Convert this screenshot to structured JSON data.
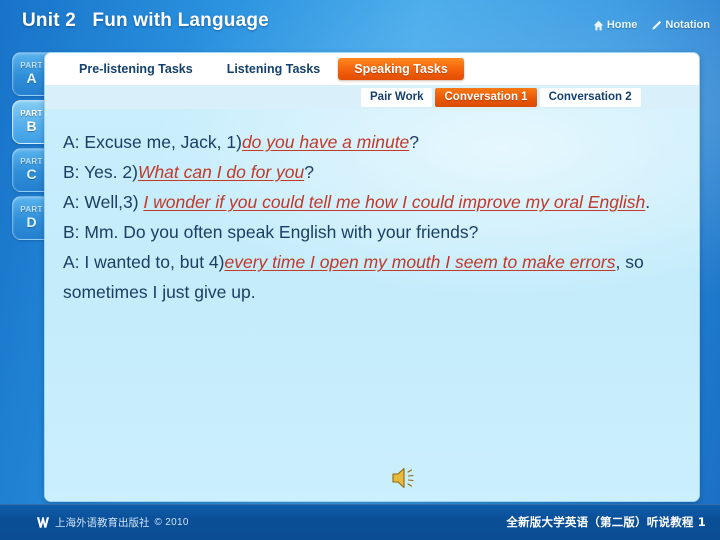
{
  "header": {
    "title": "Unit 2   Fun with Language",
    "nav": [
      {
        "label": "Home",
        "icon": "home-icon"
      },
      {
        "label": "Notation",
        "icon": "pencil-icon"
      }
    ]
  },
  "sidebar": {
    "parts": [
      {
        "top": "PART",
        "letter": "A",
        "active": false
      },
      {
        "top": "PART",
        "letter": "B",
        "active": true
      },
      {
        "top": "PART",
        "letter": "C",
        "active": false
      },
      {
        "top": "PART",
        "letter": "D",
        "active": false
      }
    ]
  },
  "tabs": [
    {
      "label": "Pre-listening Tasks",
      "active": false
    },
    {
      "label": "Listening Tasks",
      "active": false
    },
    {
      "label": "Speaking Tasks",
      "active": true
    }
  ],
  "subtabs": [
    {
      "label": "Pair Work",
      "active": false
    },
    {
      "label": "Conversation 1",
      "active": true
    },
    {
      "label": "Conversation 2",
      "active": false
    }
  ],
  "dialogue": {
    "lines": [
      {
        "segments": [
          {
            "text": "A: Excuse me, Jack, 1)",
            "answer": false
          },
          {
            "text": "do you have a minute",
            "answer": true
          },
          {
            "text": "?",
            "answer": false
          }
        ]
      },
      {
        "segments": [
          {
            "text": "B: Yes. 2)",
            "answer": false
          },
          {
            "text": "What can I do for you",
            "answer": true
          },
          {
            "text": "?",
            "answer": false
          }
        ]
      },
      {
        "segments": [
          {
            "text": "A: Well,3) ",
            "answer": false
          },
          {
            "text": "I wonder if you could tell me how I could improve my oral English",
            "answer": true
          },
          {
            "text": ".",
            "answer": false
          }
        ]
      },
      {
        "segments": [
          {
            "text": "B: Mm. Do you often speak English with your friends?",
            "answer": false
          }
        ]
      },
      {
        "segments": [
          {
            "text": "A: I wanted to, but 4)",
            "answer": false
          },
          {
            "text": "every time I open my mouth I seem to make errors",
            "answer": true
          },
          {
            "text": ", so sometimes I just give up.",
            "answer": false
          }
        ]
      }
    ]
  },
  "media": {
    "speaker_icon": "speaker-icon",
    "buttons": [
      {
        "name": "play",
        "icon": "play-icon"
      },
      {
        "name": "pause",
        "icon": "pause-icon"
      },
      {
        "name": "stop",
        "icon": "stop-icon"
      }
    ]
  },
  "pager": {
    "prev": {
      "icon": "arrow-left-icon",
      "enabled": false
    },
    "next": {
      "icon": "arrow-right-icon",
      "enabled": true
    }
  },
  "footer": {
    "publisher": "上海外语教育出版社",
    "copyright": "© 2010",
    "book_title": "全新版大学英语（第二版）听说教程 1"
  },
  "colors": {
    "accent_orange": "#ea5806",
    "answer_red": "#c0392b",
    "body_blue": "#1b3f63",
    "panel_bg": "#c9eefc",
    "chrome_blue": "#2b93e0",
    "footer_blue": "#0a4e96"
  }
}
